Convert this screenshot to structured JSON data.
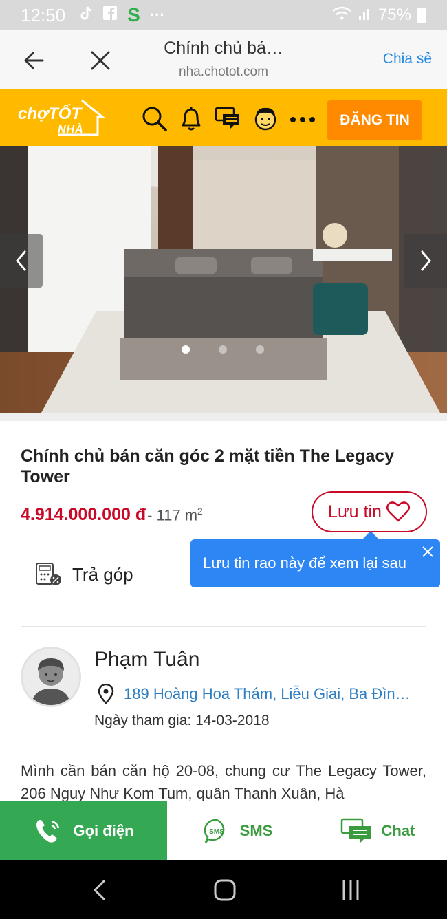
{
  "status_bar": {
    "time": "12:50",
    "icons": [
      "tiktok-icon",
      "facebook-icon",
      "s-app-icon",
      "more-dots-icon"
    ],
    "s_letter": "S",
    "dots": "···",
    "battery_text": "75%"
  },
  "browser": {
    "title": "Chính chủ bá…",
    "url": "nha.chotot.com",
    "share_label": "Chia sẻ"
  },
  "header": {
    "logo_line1": "chợTỐT",
    "logo_line2": "NHÀ",
    "post_button": "ĐĂNG TIN"
  },
  "gallery": {
    "slide_count": 3,
    "active_slide": 1
  },
  "listing": {
    "title": "Chính chủ bán căn góc 2 mặt tiền The Legacy Tower",
    "price": "4.914.000.000 đ",
    "area_prefix": "- 117 m",
    "area_sup": "2",
    "save_label": "Lưu tin",
    "installment_label": "Trả góp",
    "tooltip": "Lưu tin rao này để xem lại sau"
  },
  "seller": {
    "name": "Phạm Tuân",
    "address": "189 Hoàng Hoa Thám, Liễu Giai, Ba Đìn…",
    "joined": "Ngày tham gia: 14-03-2018"
  },
  "description": "Mình cần bán căn hộ 20-08, chung cư The Legacy Tower, 206 Nguy Như Kom Tum, quân Thanh Xuân, Hà",
  "actions": {
    "call": "Gọi điện",
    "sms": "SMS",
    "sms_icon_text": "SMS",
    "chat": "Chat"
  },
  "colors": {
    "brand_yellow": "#ffba00",
    "post_orange": "#ff8a00",
    "price_red": "#c90927",
    "call_green": "#34a853",
    "tooltip_blue": "#2e86f5",
    "link_blue": "#2f7fc4"
  }
}
